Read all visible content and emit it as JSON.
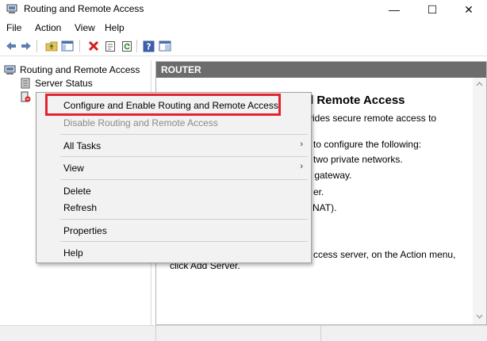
{
  "window": {
    "title": "Routing and Remote Access",
    "min_glyph": "—",
    "max_glyph": "☐",
    "close_glyph": "✕"
  },
  "menu": [
    "File",
    "Action",
    "View",
    "Help"
  ],
  "toolbar_icons": [
    "back-icon",
    "forward-icon",
    "up-folder-icon",
    "show-hide-tree-icon",
    "delete-icon",
    "properties-icon",
    "refresh-icon",
    "help-icon",
    "console-tree-icon"
  ],
  "tree": {
    "root": "Routing and Remote Access",
    "server_status": "Server Status"
  },
  "pane": {
    "header": "ROUTER",
    "heading_fragment": "d Remote Access",
    "lines": [
      "vides secure remote access to",
      "to configure the following:",
      "two private networks.",
      ") gateway.",
      "er.",
      "NAT).",
      "ccess server, on the Action menu,",
      "click Add Server."
    ]
  },
  "context_menu": {
    "configure": "Configure and Enable Routing and Remote Access",
    "disable": "Disable Routing and Remote Access",
    "all_tasks": "All Tasks",
    "view": "View",
    "delete": "Delete",
    "refresh": "Refresh",
    "properties": "Properties",
    "help": "Help",
    "submenu_arrow": "›"
  },
  "colors": {
    "highlight_border": "#e3232f",
    "pane_header_bg": "#6c6c6c",
    "menu_bg": "#f2f2f2"
  }
}
